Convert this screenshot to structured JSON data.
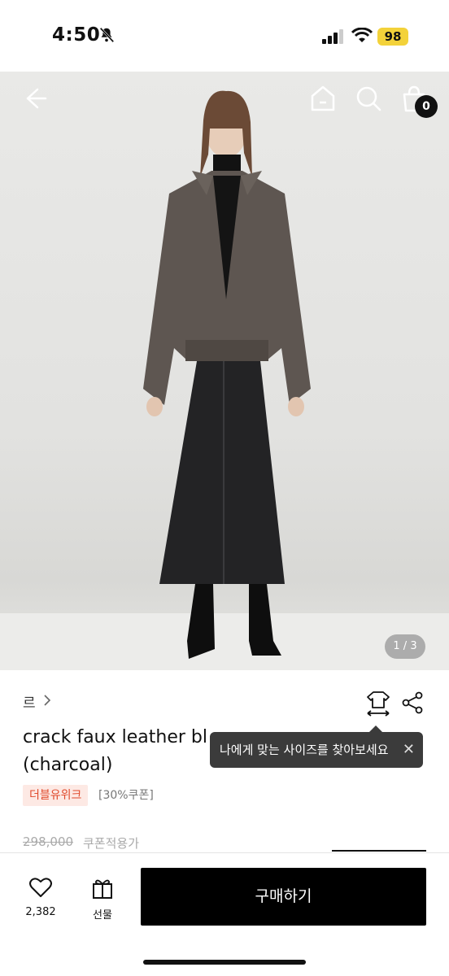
{
  "status_bar": {
    "time": "4:50",
    "battery": "98"
  },
  "hero": {
    "pager": "1 / 3",
    "cart_count": "0"
  },
  "product": {
    "brand": "르",
    "title_line1": "crack faux leather bl",
    "title_line2": "(charcoal)",
    "badge": "더블유위크",
    "coupon_tag": "[30%쿠폰]",
    "original_price": "298,000",
    "coupon_price_label": "쿠폰적용가"
  },
  "tooltip": {
    "text": "나에게 맞는 사이즈를 찾아보세요",
    "close": "✕"
  },
  "bottom_bar": {
    "like_count": "2,382",
    "gift_label": "선물",
    "buy_label": "구매하기"
  },
  "colors": {
    "badge_bg": "#fde9e4",
    "badge_text": "#e0492b",
    "buy_bg": "#000000",
    "battery": "#f3d23a"
  }
}
